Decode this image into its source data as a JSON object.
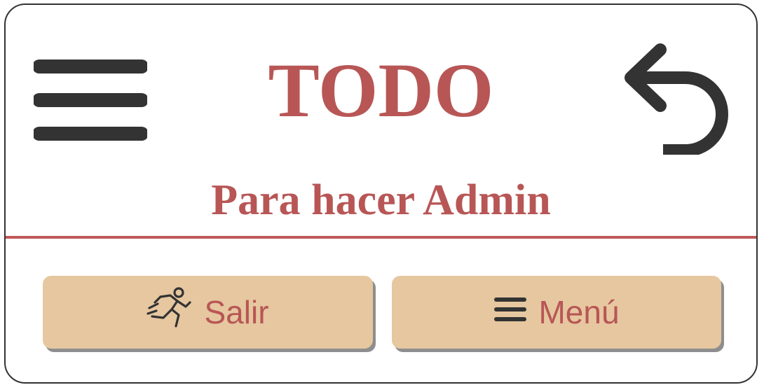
{
  "header": {
    "title": "TODO",
    "subtitle": "Para hacer Admin",
    "menu_icon": "hamburger-menu-icon",
    "back_icon": "undo-arrow-icon"
  },
  "buttons": {
    "exit": {
      "label": "Salir",
      "icon": "running-person-icon"
    },
    "menu": {
      "label": "Menú",
      "icon": "hamburger-icon"
    }
  },
  "colors": {
    "accent": "#b85656",
    "divider": "#c05858",
    "button_bg": "#e6c7a0",
    "icon": "#333333",
    "border": "#333333"
  }
}
